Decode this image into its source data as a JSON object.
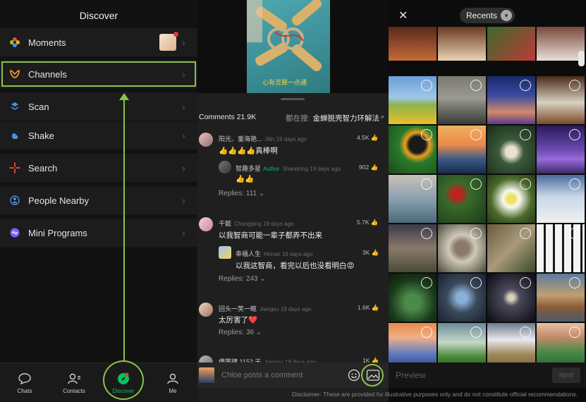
{
  "left_panel": {
    "title": "Discover",
    "menu": [
      {
        "label": "Moments",
        "icon": "moments-icon"
      },
      {
        "label": "Channels",
        "icon": "channels-icon"
      },
      {
        "label": "Scan",
        "icon": "scan-icon"
      },
      {
        "label": "Shake",
        "icon": "shake-icon"
      },
      {
        "label": "Search",
        "icon": "search-icon"
      },
      {
        "label": "People Nearby",
        "icon": "people-nearby-icon"
      },
      {
        "label": "Mini Programs",
        "icon": "mini-programs-icon"
      }
    ],
    "tabs": [
      {
        "label": "Chats",
        "icon": "chat-bubble-icon"
      },
      {
        "label": "Contacts",
        "icon": "contacts-icon"
      },
      {
        "label": "Discover",
        "icon": "compass-icon",
        "active": true
      },
      {
        "label": "Me",
        "icon": "person-icon"
      }
    ],
    "accent": "#07c160",
    "highlight_color": "#8bc34a"
  },
  "middle_panel": {
    "video_caption": "心有灵犀一点通",
    "comments_count": "Comments 21.9K",
    "search_label": "都在搜:",
    "search_term": "金蝉脱壳智力环解法",
    "comments": [
      {
        "name": "阳光、董海艳...",
        "meta": "Jilin 19 days ago",
        "likes": "4.5K",
        "text": "👍👍👍👍真棒啊"
      },
      {
        "name": "智趣多星",
        "author_tag": "Author",
        "meta": "Shandong 19 days ago",
        "likes": "902",
        "text": "👍👍"
      },
      {
        "name": "干懿",
        "meta": "Chongqing 19 days ago",
        "likes": "5.7K",
        "text": "以我智商可能一辈子都弄不出来"
      },
      {
        "name": "幸福人生",
        "meta": "Henan 16 days ago",
        "likes": "3K",
        "text": "以我这智商，看完以后也没看明白😡"
      },
      {
        "name": "回头一笑一眶",
        "meta": "Jiangsu 19 days ago",
        "likes": "1.6K",
        "text": "太厉害了❤️"
      },
      {
        "name": "傅茜捷 1152 干",
        "meta": "Jiangsu 19 days ago",
        "likes": "1K",
        "text": ""
      }
    ],
    "replies": [
      "Replies: 111",
      "Replies: 243",
      "Replies: 36"
    ],
    "input_placeholder": "Chloe posts a comment"
  },
  "right_panel": {
    "album_label": "Recents",
    "preview_label": "Preview",
    "next_label": "Next"
  },
  "disclaimer": "Disclaimer: These are provided for illustrative purposes only and do not constitute official recommendations."
}
